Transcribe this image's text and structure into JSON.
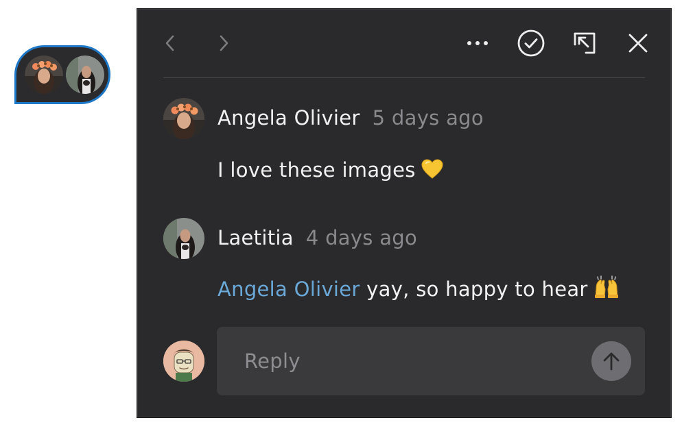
{
  "pin": {
    "avatars": [
      "avatar-angela",
      "avatar-laetitia"
    ]
  },
  "toolbar": {
    "prev_icon": "chevron-left-icon",
    "next_icon": "chevron-right-icon",
    "more_icon": "more-horizontal-icon",
    "resolve_icon": "check-circle-icon",
    "popout_icon": "arrow-up-left-box-icon",
    "close_icon": "close-icon"
  },
  "comments": [
    {
      "author": "Angela Olivier",
      "time": "5 days ago",
      "mention": "",
      "text": "I love these images",
      "emoji": "yellow-heart"
    },
    {
      "author": "Laetitia",
      "time": "4 days ago",
      "mention": "Angela Olivier",
      "text": " yay, so happy to hear",
      "emoji": "raising-hands"
    }
  ],
  "reply": {
    "placeholder": "Reply",
    "value": "",
    "send_icon": "arrow-up-icon"
  },
  "colors": {
    "panel_bg": "#2a292b",
    "accent_pin_border": "#1e78c8",
    "mention": "#6aa8d8",
    "muted_text": "#8a898d"
  }
}
